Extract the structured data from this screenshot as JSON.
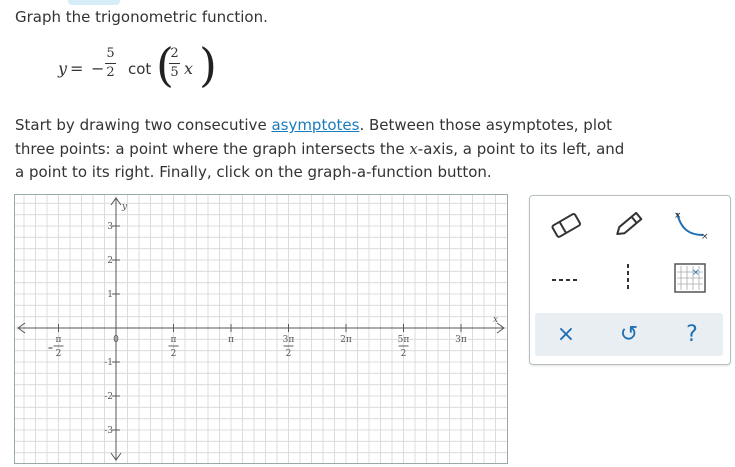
{
  "prompt": "Graph the trigonometric function.",
  "equation": {
    "lhs": "y",
    "equals": "=",
    "minus": "−",
    "coef_num": "5",
    "coef_den": "2",
    "func": "cot",
    "arg_num": "2",
    "arg_den": "5",
    "arg_var": "x"
  },
  "instructions": {
    "part1": "Start by drawing two consecutive ",
    "link": "asymptotes",
    "part2": ". Between those asymptotes, plot three points: a point where the graph intersects the ",
    "var": "x",
    "part3": "-axis, a point to its left, and a point to its right. Finally, click on the graph-a-function button."
  },
  "graph": {
    "x_axis_label": "x",
    "y_axis_label": "y",
    "x_ticks": [
      {
        "num": "π",
        "den": "2",
        "neg": true
      },
      {
        "num": "0",
        "den": "",
        "neg": false
      },
      {
        "num": "π",
        "den": "2",
        "neg": false
      },
      {
        "num": "π",
        "den": "",
        "neg": false
      },
      {
        "num": "3π",
        "den": "2",
        "neg": false
      },
      {
        "num": "2π",
        "den": "",
        "neg": false
      },
      {
        "num": "5π",
        "den": "2",
        "neg": false
      },
      {
        "num": "3π",
        "den": "",
        "neg": false
      }
    ],
    "y_ticks": [
      "3",
      "2",
      "1",
      "-1",
      "-2",
      "-3"
    ]
  },
  "toolbar": {
    "tools": [
      "eraser-icon",
      "pencil-icon",
      "curve-tool-icon",
      "dashed-line-icon",
      "vertical-dashed-line-icon",
      "graph-function-icon"
    ],
    "actions": {
      "clear": "×",
      "undo": "↺",
      "help": "?"
    }
  }
}
